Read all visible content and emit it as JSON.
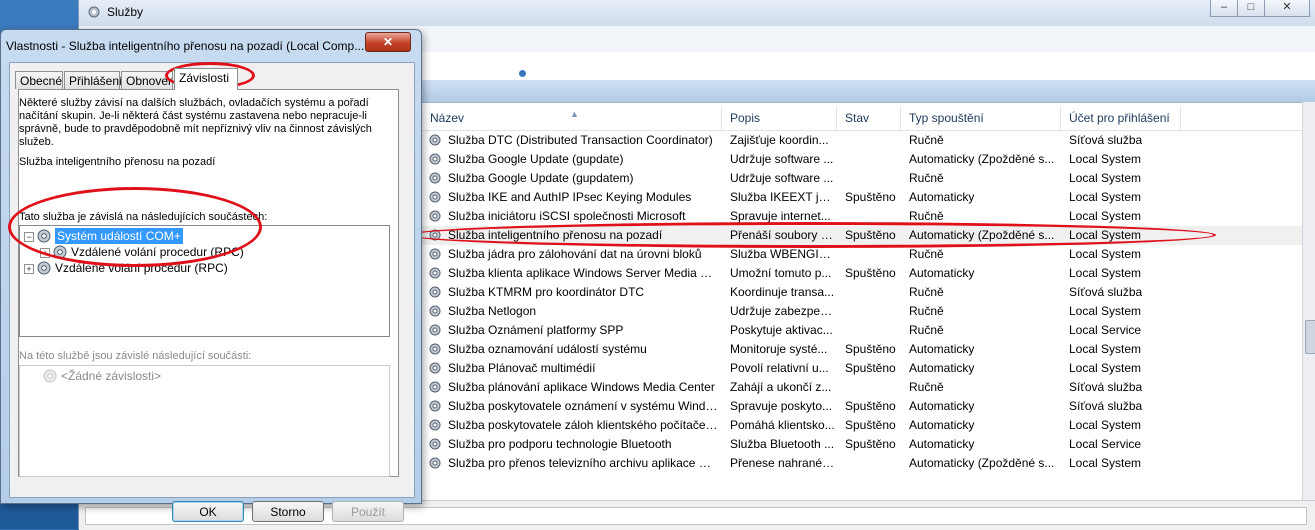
{
  "services_window": {
    "title": "Služby",
    "columns": [
      "Název",
      "Popis",
      "Stav",
      "Typ spouštění",
      "Účet pro přihlášení"
    ],
    "rows": [
      [
        "Služba DTC (Distributed Transaction Coordinator)",
        "Zajišťuje koordin...",
        "",
        "Ručně",
        "Síťová služba"
      ],
      [
        "Služba Google Update (gupdate)",
        "Udržuje software ...",
        "",
        "Automaticky (Zpožděné s...",
        "Local System"
      ],
      [
        "Služba Google Update (gupdatem)",
        "Udržuje software ...",
        "",
        "Ručně",
        "Local System"
      ],
      [
        "Služba IKE and AuthIP IPsec Keying Modules",
        "Služba IKEEXT je ...",
        "Spuštěno",
        "Automaticky",
        "Local System"
      ],
      [
        "Služba iniciátoru iSCSI společnosti Microsoft",
        "Spravuje internet...",
        "",
        "Ručně",
        "Local System"
      ],
      [
        "Služba inteligentního přenosu na pozadí",
        "Přenáší soubory n...",
        "Spuštěno",
        "Automaticky (Zpožděné s...",
        "Local System"
      ],
      [
        "Služba jádra pro zálohování dat na úrovni bloků",
        "Služba WBENGIN...",
        "",
        "Ručně",
        "Local System"
      ],
      [
        "Služba klienta aplikace Windows Server Media Cen...",
        "Umožní tomuto p...",
        "Spuštěno",
        "Automaticky",
        "Local System"
      ],
      [
        "Služba KTMRM pro koordinátor DTC",
        "Koordinuje transa...",
        "",
        "Ručně",
        "Síťová služba"
      ],
      [
        "Služba Netlogon",
        "Udržuje zabezpeč...",
        "",
        "Ručně",
        "Local System"
      ],
      [
        "Služba Oznámení platformy SPP",
        "Poskytuje aktivac...",
        "",
        "Ručně",
        "Local Service"
      ],
      [
        "Služba oznamování událostí systému",
        "Monitoruje systé...",
        "Spuštěno",
        "Automaticky",
        "Local System"
      ],
      [
        "Služba Plánovač multimédií",
        "Povolí relativní u...",
        "Spuštěno",
        "Automaticky",
        "Local System"
      ],
      [
        "Služba plánování aplikace Windows Media Center",
        "Zahájí a ukončí z...",
        "",
        "Ručně",
        "Síťová služba"
      ],
      [
        "Služba poskytovatele oznámení v systému Windo...",
        "Spravuje poskyto...",
        "Spuštěno",
        "Automaticky",
        "Síťová služba"
      ],
      [
        "Služba poskytovatele záloh klientského počítače v ...",
        "Pomáhá klientsko...",
        "Spuštěno",
        "Automaticky",
        "Local System"
      ],
      [
        "Služba pro podporu technologie Bluetooth",
        "Služba Bluetooth ...",
        "Spuštěno",
        "Automaticky",
        "Local Service"
      ],
      [
        "Služba pro přenos televizního archivu aplikace Win...",
        "Přenese nahrané ...",
        "",
        "Automaticky (Zpožděné s...",
        "Local System"
      ]
    ],
    "selected_row": 5
  },
  "dialog": {
    "title": "Vlastnosti - Služba inteligentního přenosu na pozadí (Local Comp...",
    "close_label": "✕",
    "tabs": [
      "Obecné",
      "Přihlášení",
      "Obnovení",
      "Závislosti"
    ],
    "active_tab": "Závislosti",
    "description": "Některé služby závisí na dalších službách, ovladačích systému a pořadí načítání skupin. Je-li některá část systému zastavena nebo nepracuje-li správně, bude to pravděpodobně mít nepříznivý vliv na činnost závislých služeb.",
    "service_name": "Služba inteligentního přenosu na pozadí",
    "depends_on_label": "Tato služba je závislá na následujících součástech:",
    "depends_on_tree": [
      {
        "label": "Systém událostí COM+",
        "level": 0,
        "expanded": true
      },
      {
        "label": "Vzdálené volání procedur (RPC)",
        "level": 1,
        "expanded": false
      },
      {
        "label": "Vzdálené volání procedur (RPC)",
        "level": 0,
        "expanded": false
      }
    ],
    "dependents_label": "Na této službě jsou závislé následující součásti:",
    "dependents_item": "<Žádné závislosti>",
    "buttons": {
      "ok": "OK",
      "cancel": "Storno",
      "apply": "Použít"
    }
  },
  "colors": {
    "annotation": "#e0101a",
    "selection": "#3399ff"
  }
}
